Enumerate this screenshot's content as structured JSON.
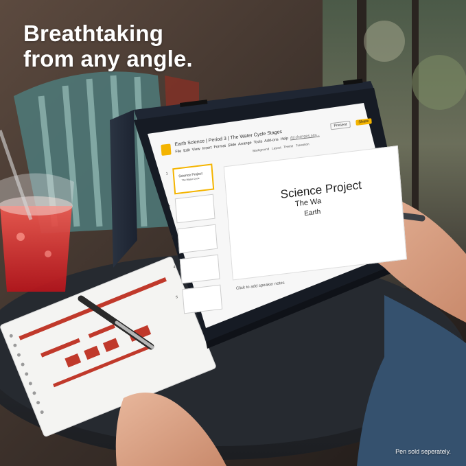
{
  "headline": {
    "line1": "Breathtaking",
    "line2": "from any angle."
  },
  "footnote": "Pen sold seperately.",
  "screen": {
    "doc_title": "Earth Science | Period 3 | The Water Cycle Stages",
    "menu": [
      "File",
      "Edit",
      "View",
      "Insert",
      "Format",
      "Slide",
      "Arrange",
      "Tools",
      "Add-ons",
      "Help"
    ],
    "save_status": "All changes sav...",
    "present_label": "Present",
    "share_label": "Share",
    "slide_title_large": "Science Project",
    "slide_subtitle_partial": "The Wa",
    "slide_subtitle_partial2": "Earth",
    "thumb1_title": "Science Project",
    "thumb1_sub": "The Water Cycle",
    "speaker_notes": "Click to add speaker notes",
    "toolbar_items": [
      "Background",
      "Layout",
      "Theme",
      "Transition"
    ],
    "slide_numbers": [
      "1",
      "2",
      "3",
      "4",
      "5"
    ]
  },
  "colors": {
    "slides_accent": "#f4b400",
    "share_button": "#f4b400",
    "notebook_marks": "#c0392b",
    "drink": "#d6262b"
  }
}
